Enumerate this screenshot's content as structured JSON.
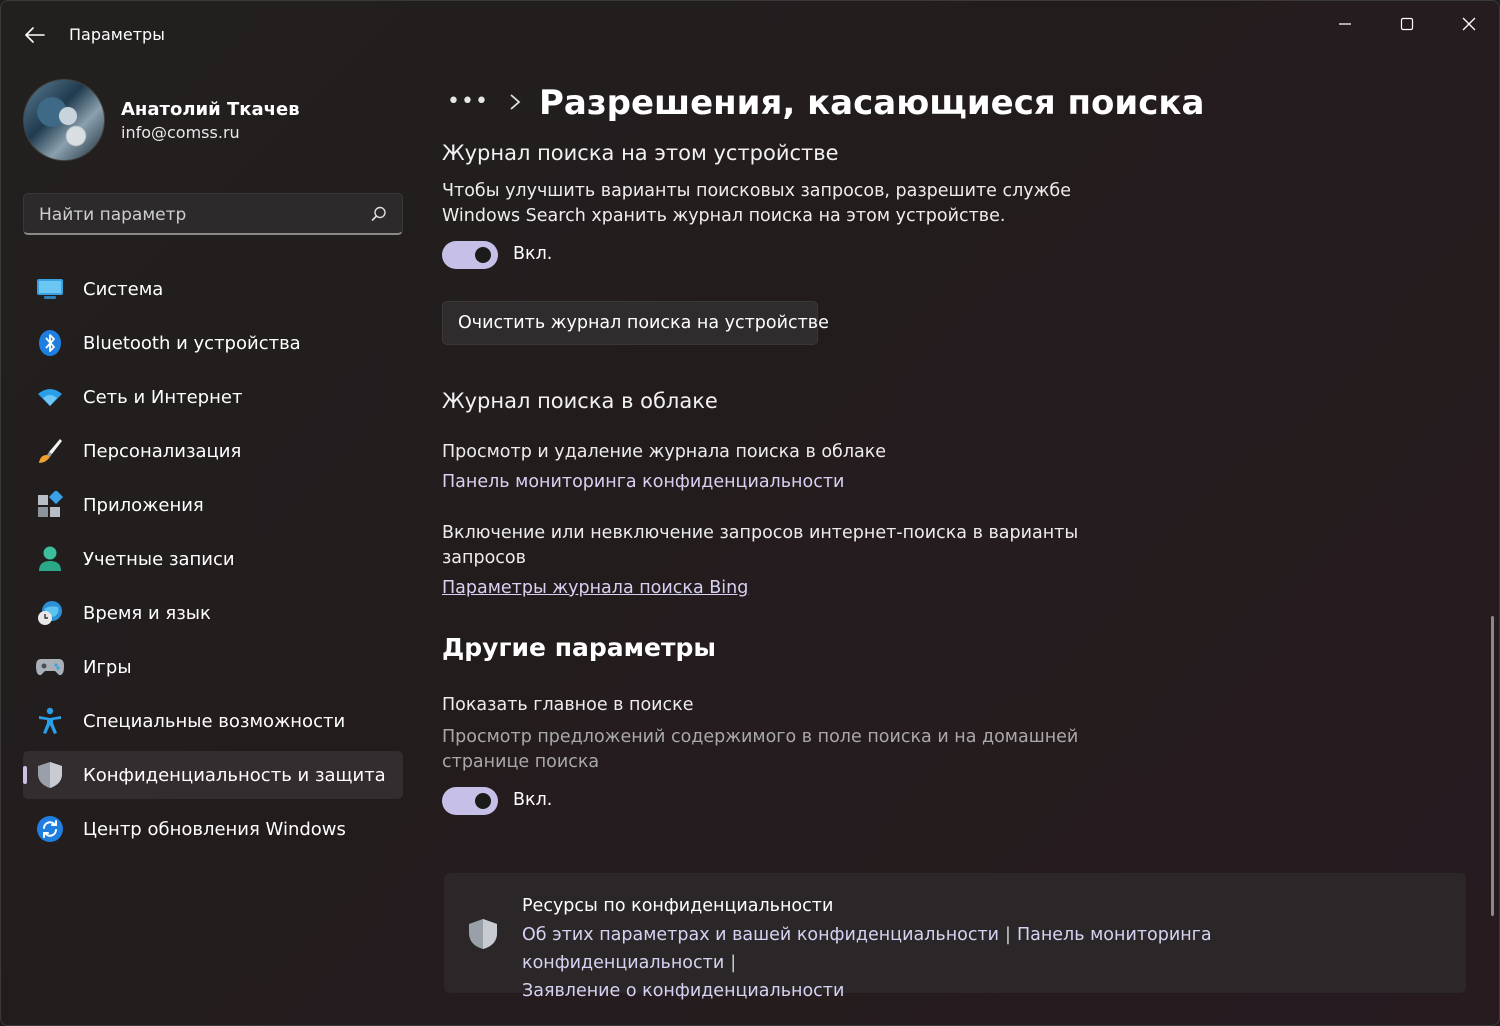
{
  "app": {
    "title": "Параметры"
  },
  "window_controls": {
    "minimize_icon": "minimize-icon",
    "maximize_icon": "maximize-icon",
    "close_icon": "close-icon"
  },
  "profile": {
    "name": "Анатолий Ткачев",
    "email": "info@comss.ru"
  },
  "search": {
    "placeholder": "Найти параметр"
  },
  "sidebar": {
    "items": [
      {
        "label": "Система",
        "icon": "monitor-icon"
      },
      {
        "label": "Bluetooth и устройства",
        "icon": "bluetooth-icon"
      },
      {
        "label": "Сеть и Интернет",
        "icon": "wifi-icon"
      },
      {
        "label": "Персонализация",
        "icon": "brush-icon"
      },
      {
        "label": "Приложения",
        "icon": "apps-icon"
      },
      {
        "label": "Учетные записи",
        "icon": "person-icon"
      },
      {
        "label": "Время и язык",
        "icon": "globe-clock-icon"
      },
      {
        "label": "Игры",
        "icon": "gamepad-icon"
      },
      {
        "label": "Специальные возможности",
        "icon": "accessibility-icon"
      },
      {
        "label": "Конфиденциальность и защита",
        "icon": "shield-icon",
        "selected": true
      },
      {
        "label": "Центр обновления Windows",
        "icon": "sync-icon"
      }
    ]
  },
  "breadcrumb": {
    "dots": "•••",
    "title": "Разрешения, касающиеся поиска"
  },
  "device_history": {
    "heading": "Журнал поиска на этом устройстве",
    "description_line1": "Чтобы улучшить варианты поисковых запросов, разрешите службе",
    "description_line2": "Windows Search хранить журнал поиска на этом устройстве.",
    "toggle_state": "Вкл.",
    "toggle_on": true,
    "clear_button": "Очистить журнал поиска на устройстве"
  },
  "cloud_history": {
    "heading": "Журнал поиска в облаке",
    "view_title": "Просмотр и удаление журнала поиска в облаке",
    "dashboard_link": "Панель мониторинга конфиденциальности",
    "include_title_line1": "Включение или невключение запросов интернет-поиска в варианты",
    "include_title_line2": "запросов",
    "bing_link": "Параметры журнала поиска Bing"
  },
  "other": {
    "heading": "Другие параметры",
    "highlights_title": "Показать главное в поиске",
    "highlights_desc_line1": "Просмотр предложений содержимого в поле поиска и на домашней",
    "highlights_desc_line2": "странице поиска",
    "toggle_state": "Вкл.",
    "toggle_on": true
  },
  "resources": {
    "title": "Ресурсы по конфиденциальности",
    "link1": "Об этих параметрах и вашей конфиденциальности",
    "separator": "|",
    "link2": "Панель мониторинга конфиденциальности",
    "link3": "Заявление о конфиденциальности"
  },
  "colors": {
    "accent": "#c6c0e8",
    "link": "#d8d2f2",
    "background": "#231c1d"
  }
}
